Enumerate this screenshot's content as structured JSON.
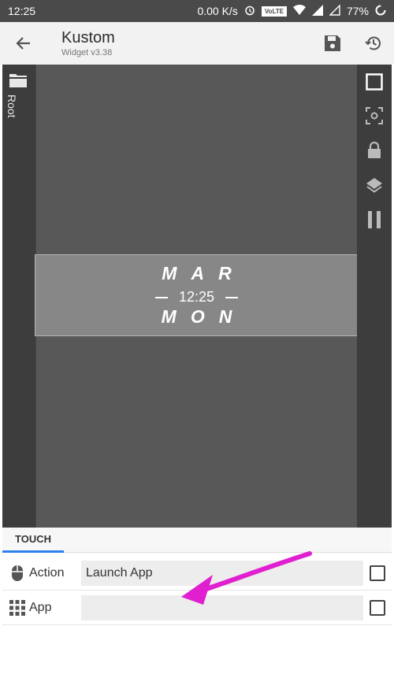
{
  "status_bar": {
    "time": "12:25",
    "network_speed": "0.00 K/s",
    "volte": "VoLTE",
    "battery": "77%"
  },
  "app_bar": {
    "title": "Kustom",
    "subtitle": "Widget v3.38"
  },
  "left_rail": {
    "root_label": "Root"
  },
  "widget": {
    "month": "MAR",
    "time": "12:25",
    "day": "MON"
  },
  "panel": {
    "tab_label": "TOUCH",
    "rows": [
      {
        "label": "Action",
        "value": "Launch App"
      },
      {
        "label": "App",
        "value": ""
      }
    ]
  },
  "colors": {
    "status_bar": "#4a4a4a",
    "canvas": "#585858",
    "annotation_arrow": "#e020d0",
    "tab_indicator": "#2f80ed"
  },
  "icons": [
    "back-arrow-icon",
    "save-icon",
    "history-icon",
    "folder-icon",
    "square-icon",
    "focus-icon",
    "lock-icon",
    "layers-icon",
    "pause-icon",
    "mouse-icon",
    "grid-icon"
  ]
}
